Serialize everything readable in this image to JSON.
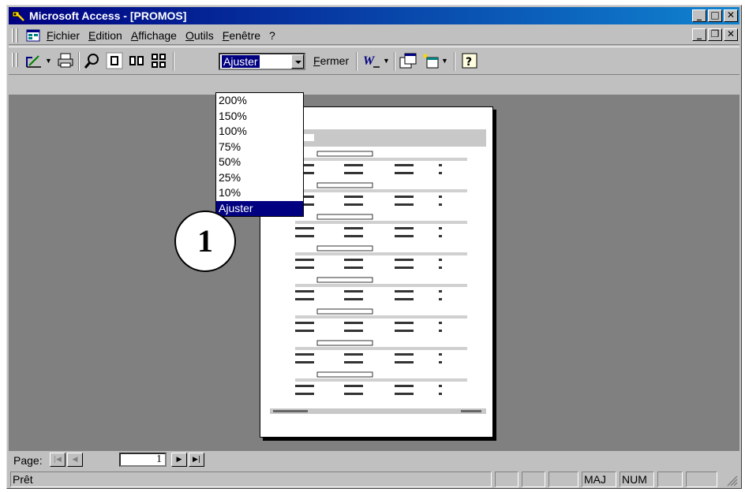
{
  "window": {
    "title": "Microsoft Access - [PROMOS]",
    "caption_buttons": {
      "minimize": "_",
      "maximize": "□",
      "close": "✕"
    }
  },
  "menubar": {
    "items": [
      "Fichier",
      "Edition",
      "Affichage",
      "Outils",
      "Fenêtre",
      "?"
    ],
    "mdi_buttons": {
      "minimize": "_",
      "restore": "❐",
      "close": "✕"
    }
  },
  "toolbar": {
    "icons": [
      "design-view-icon",
      "print-icon",
      "zoom-icon",
      "one-page-icon",
      "two-pages-icon",
      "multiple-pages-icon",
      "office-links-icon",
      "database-window-icon",
      "new-object-icon",
      "help-icon"
    ],
    "zoom_value": "Ajuster",
    "close_label": "Fermer"
  },
  "zoom_menu": {
    "options": [
      "200%",
      "150%",
      "100%",
      "75%",
      "50%",
      "25%",
      "10%",
      "Ajuster"
    ],
    "selected": "Ajuster"
  },
  "callout": {
    "label": "1"
  },
  "navigation": {
    "label": "Page:",
    "current_page": "1"
  },
  "status": {
    "text": "Prêt",
    "indicators": [
      "MAJ",
      "NUM"
    ]
  },
  "colors": {
    "title_bar": "#000080",
    "face": "#c0c0c0",
    "workspace": "#808080",
    "selection": "#000080"
  }
}
